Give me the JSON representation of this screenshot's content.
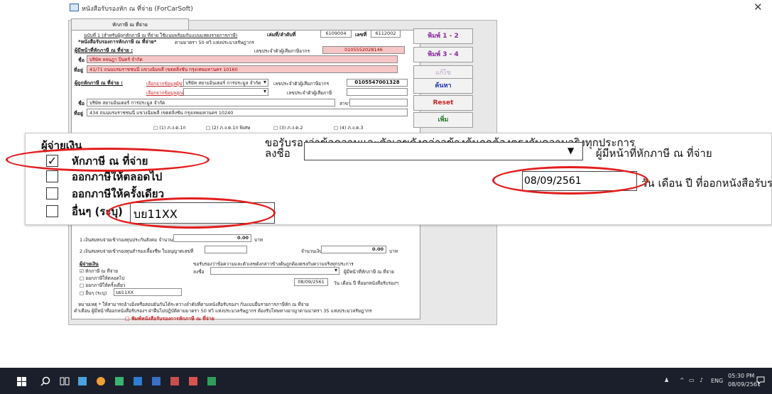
{
  "window": {
    "title": "หนังสือรับรองหัก ณ ที่จ่าย (ForCarSoft)"
  },
  "form": {
    "tab_label": "หักภาษี ณ ที่จ่าย",
    "header_line1": "ฉบับที่ 1 (สำหรับผู้ถูกหักภาษี ณ ที่จ่าย ใช้แนบพร้อมกับแบบแสดงรายการภาษี)",
    "header_line2": "*หนังสือรับรองการหักภาษี ณ ที่จ่าย*",
    "header_law": "ตามมาตรา 50 ทวิ แห่งประมวลรัษฎากร",
    "book_no_label": "เล่มที่/ลำดับที่",
    "book_no_value": "6109004",
    "no_label": "เลขที่",
    "no_value": "6112002",
    "payer_section": "ผู้มีหน้าที่หักภาษี ณ ที่จ่าย :",
    "payer_taxid_label": "เลขประจำตัวผู้เสียภาษีอากร",
    "payer_taxid": "0105552028146",
    "name_label": "ชื่อ",
    "address_label": "ที่อยู่",
    "payer_name": "บริษัท ลลนฎา ปิ่นทร์ จำกัด",
    "payer_address": "41/71 ถนนบรมราชชนนี แขวงฉิมพลี เขตตลิ่งชัน กรุงเทพมหานคร 10160",
    "payee_section": "ผู้ถูกหักภาษี ณ ที่จ่าย :",
    "select_payee_link": "เลือกจากข้อมูลผู้ขาย",
    "select_customer_link": "เลือกจากข้อมูลลูกค้า",
    "payee_combo": "บริษัท สยามอินเตอร์ การประมูล จำกัด",
    "payee_taxid_label": "เลขประจำตัวผู้เสียภาษีอากร",
    "payee_taxid": "0105547001328",
    "payee_id_label": "เลขประจำตัวผู้เสียภาษี",
    "branch_label": "สาขา",
    "payee_name": "บริษัท สยามอินเตอร์ การประมูล จำกัด",
    "payee_address": "434 ถนนบรมราชชนนี แขวงฉิมพลี เขตตลิ่งชัน กรุงเทพมหานคร 10240",
    "pnd_1a": "(1) ภ.ง.ด.1ก",
    "pnd_1a_special": "(2) ภ.ง.ด.1ก พิเศษ",
    "pnd_2": "(3) ภ.ง.ด.2",
    "pnd_3": "(4) ภ.ง.ด.3",
    "fund_line1": "1.เงินสมทบจ่ายเข้ากองทุนประกันสังคม จำนวนเงิน",
    "fund_line2": "2.เงินสมทบจ่ายเข้ากองทุนสำรองเลี้ยงชีพ ใบอนุญาตเลขที่",
    "amount_label": "จำนวนเงิน",
    "amount1": "0.00",
    "amount2": "0.00",
    "baht": "บาท",
    "payer_mini": "ผู้จ่ายเงิน",
    "opt_withhold_mini": "หักภาษี ณ ที่จ่าย",
    "opt_always_mini": "ออกภาษีให้ตลอดไป",
    "opt_once_mini": "ออกภาษีให้ครั้งเดียว",
    "opt_other_mini": "อื่นๆ (ระบุ)",
    "other_value_mini": "บย11XX",
    "certify_mini": "ขอรับรองว่าข้อความและตัวเลขดังกล่าวข้างต้นถูกต้องตรงกับความจริงทุกประการ",
    "sign_mini": "ลงชื่อ",
    "signer_role_mini": "ผู้มีหน้าที่หักภาษี ณ ที่จ่าย",
    "date_mini": "08/09/2561",
    "date_label_mini": "วัน เดือน ปี ที่ออกหนังสือรับรองฯ",
    "note_line1": "หมายเหตุ * ให้สามารถอ้างอิงหรือสอบยันกันได้ระหว่างลำดับที่ตามหนังสือรับรองฯ กับแบบยื่นรายการภาษีหัก ณ ที่จ่าย",
    "note_line2": "คำเตือน   ผู้มีหน้าที่ออกหนังสือรับรองฯ ฝ่าฝืนไม่ปฏิบัติตามมาตรา 50 ทวิ แห่งประมวลรัษฎากร ต้องรับโทษทางอาญาตามมาตรา 35 แห่งประมวลรัษฎากร",
    "print_cert_checkbox": "พิมพ์หนังสือรับรองการหักภาษี ณ ที่จ่าย"
  },
  "buttons": {
    "print12": "พิมพ์ 1 - 2",
    "print34": "พิมพ์ 3 - 4",
    "edit": "แก้ไข",
    "save": "ค้นหา",
    "reset": "Reset",
    "add": "เพิ่ม"
  },
  "zoom": {
    "payer_heading": "ผู้จ่ายเงิน",
    "opt_withhold": "หักภาษี ณ ที่จ่าย",
    "opt_always": "ออกภาษีให้ตลอดไป",
    "opt_once": "ออกภาษีให้ครั้งเดียว",
    "opt_other": "อื่นๆ (ระบุ)",
    "other_value": "บย11XX",
    "certify": "ขอรับรองว่าข้อความและตัวเลขดังกล่าวข้างต้นถูกต้องตรงกับความจริงทุกประการ",
    "sign_label": "ลงชื่อ",
    "signer_role": "ผู้มีหน้าที่หักภาษี ณ ที่จ่าย",
    "date_value": "08/09/2561",
    "date_label": "วัน เดือน ปี ที่ออกหนังสือรับรองฯ"
  },
  "taskbar": {
    "language": "ENG",
    "time": "05:30 PM",
    "date": "08/09/2561"
  },
  "colors": {
    "highlight_ellipse": "#e31d1d",
    "pink_field": "#f6c6c6",
    "taskbar": "#1a1f2b",
    "link_red": "#cc2222"
  }
}
